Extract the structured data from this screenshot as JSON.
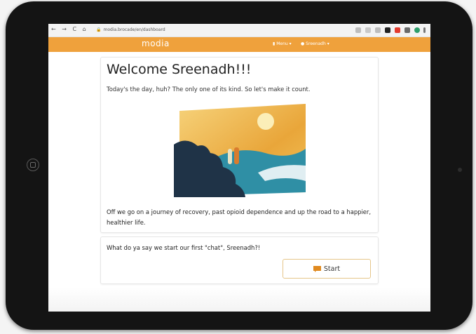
{
  "browser": {
    "nav_buttons": "← → C ⌂",
    "url": "modia.brocade/en/dashboard"
  },
  "appbar": {
    "brand": "modia",
    "menu_label": "Menu",
    "user_label": "Sreenadh",
    "color": "#efa13c"
  },
  "welcome_card": {
    "title": "Welcome Sreenadh!!!",
    "tagline": "Today's the day, huh? The only one of its kind. So let's make it count.",
    "journey_text": "Off we go on a journey of recovery, past opioid dependence and up the road to a happier, healthier life."
  },
  "chat_card": {
    "prompt": "What do ya say we start our first \"chat\", Sreenadh?!",
    "start_label": "Start"
  },
  "icons": {
    "lock": "lock-icon",
    "chat": "chat-bubble-icon",
    "user": "user-icon",
    "caret": "caret-down-icon"
  }
}
